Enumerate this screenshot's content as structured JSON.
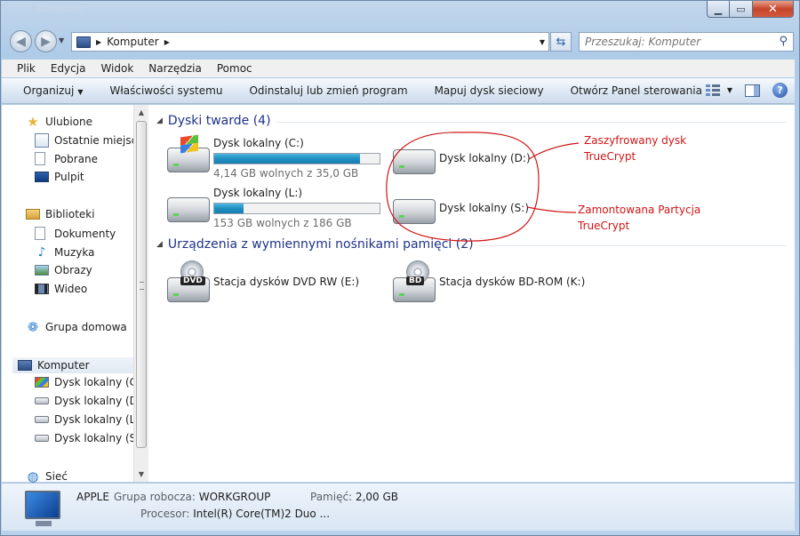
{
  "window": {
    "title": "Komputer"
  },
  "address_bar": {
    "crumb": "Komputer"
  },
  "search": {
    "placeholder": "Przeszukaj: Komputer"
  },
  "menu": [
    "Plik",
    "Edycja",
    "Widok",
    "Narzędzia",
    "Pomoc"
  ],
  "toolbar": {
    "items": [
      "Organizuj",
      "Właściwości systemu",
      "Odinstaluj lub zmień program",
      "Mapuj dysk sieciowy",
      "Otwórz Panel sterowania"
    ]
  },
  "sidebar": {
    "favorites": {
      "label": "Ulubione",
      "items": [
        "Ostatnie miejsca",
        "Pobrane",
        "Pulpit"
      ]
    },
    "libraries": {
      "label": "Biblioteki",
      "items": [
        "Dokumenty",
        "Muzyka",
        "Obrazy",
        "Wideo"
      ]
    },
    "homegroup": {
      "label": "Grupa domowa"
    },
    "computer": {
      "label": "Komputer",
      "items": [
        "Dysk lokalny (C:)",
        "Dysk lokalny (D:)",
        "Dysk lokalny (L:)",
        "Dysk lokalny (S:)"
      ]
    },
    "network": {
      "label": "Sieć"
    }
  },
  "content": {
    "hard_disks_header": "Dyski twarde (4)",
    "removable_header": "Urządzenia z wymiennymi nośnikami pamięci (2)",
    "drives": [
      {
        "name": "Dysk lokalny (C:)",
        "free": "4,14 GB wolnych z 35,0 GB",
        "used_fraction": 0.88
      },
      {
        "name": "Dysk lokalny (D:)"
      },
      {
        "name": "Dysk lokalny (L:)",
        "free": "153 GB wolnych z 186 GB",
        "used_fraction": 0.18
      },
      {
        "name": "Dysk lokalny (S:)"
      }
    ],
    "removable": [
      {
        "name": "Stacja dysków DVD RW (E:)",
        "badge": "DVD"
      },
      {
        "name": "Stacja dysków BD-ROM (K:)",
        "badge": "BD"
      }
    ]
  },
  "annotations": {
    "encrypted": {
      "line1": "Zaszyfrowany dysk",
      "line2": "TrueCrypt"
    },
    "mounted": {
      "line1": "Zamontowana Partycja",
      "line2": "TrueCrypt"
    },
    "color": "#d01515"
  },
  "details": {
    "computer_name": "APPLE",
    "workgroup_label": "Grupa robocza:",
    "workgroup": "WORKGROUP",
    "memory_label": "Pamięć:",
    "memory": "2,00 GB",
    "cpu_label": "Procesor:",
    "cpu": "Intel(R) Core(TM)2 Duo ..."
  }
}
